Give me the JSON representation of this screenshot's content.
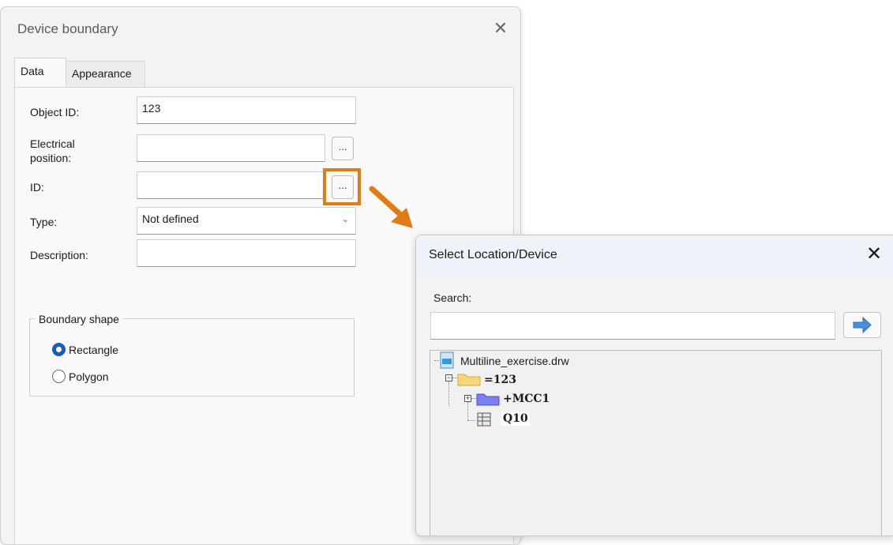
{
  "device_boundary_dialog": {
    "title": "Device boundary",
    "tabs": [
      {
        "label": "Data",
        "active": true
      },
      {
        "label": "Appearance",
        "active": false
      }
    ],
    "fields": {
      "object_id": {
        "label": "Object ID:",
        "value": "123"
      },
      "electrical_position": {
        "label_line1": "Electrical",
        "label_line2": "position:",
        "value": ""
      },
      "id": {
        "label": "ID:",
        "value": ""
      },
      "type": {
        "label": "Type:",
        "value": "Not defined"
      },
      "description": {
        "label": "Description:",
        "value": ""
      }
    },
    "browse_button_label": "...",
    "boundary_shape": {
      "legend": "Boundary shape",
      "options": [
        {
          "label": "Rectangle",
          "selected": true
        },
        {
          "label": "Polygon",
          "selected": false
        }
      ]
    }
  },
  "select_location_dialog": {
    "title": "Select Location/Device",
    "search_label": "Search:",
    "search_value": "",
    "tree": {
      "root": "Multiline_exercise.drw",
      "nodes": [
        {
          "label": "=123"
        },
        {
          "label": "+MCC1"
        },
        {
          "label": "Q10"
        }
      ]
    }
  },
  "colors": {
    "highlight": "#e07b15",
    "radio_selected": "#1a5fb4",
    "go_arrow": "#4a8fdc"
  }
}
